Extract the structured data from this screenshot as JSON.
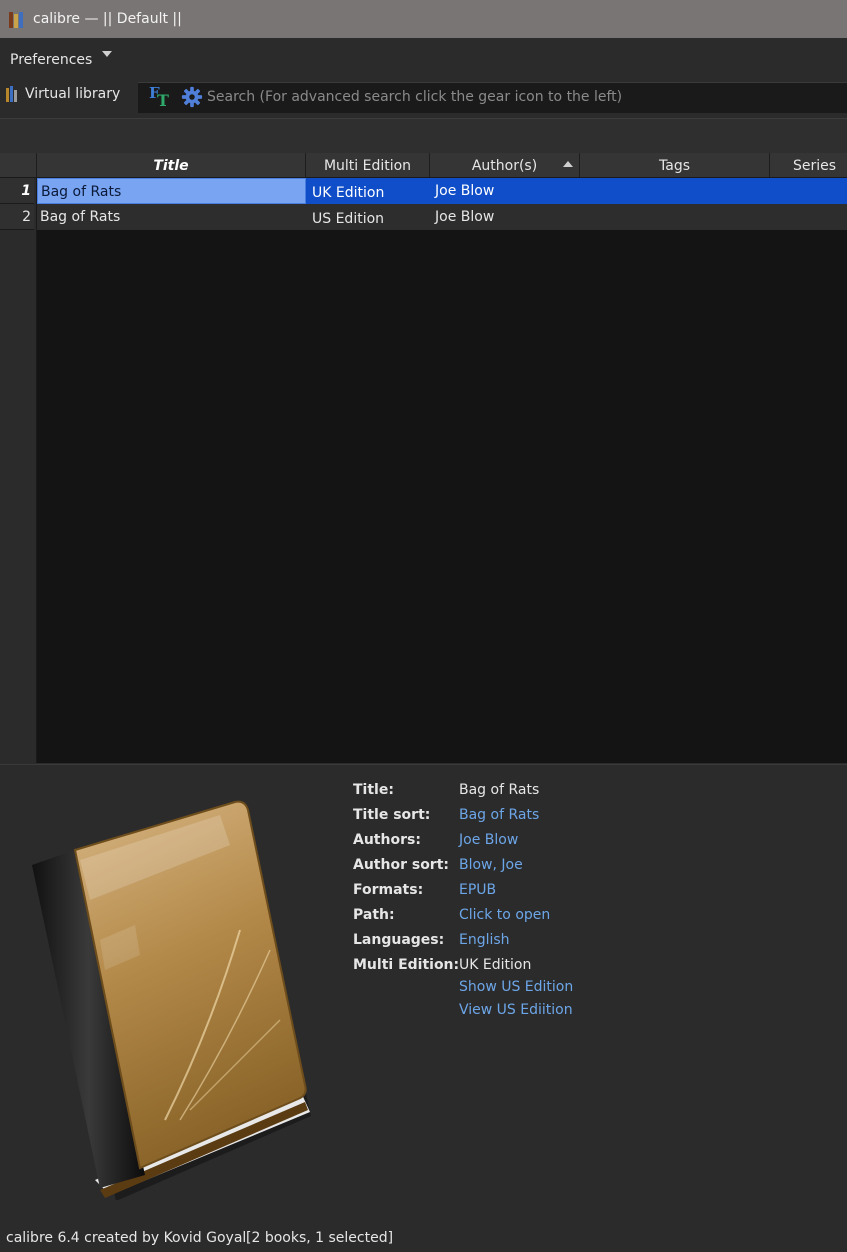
{
  "window": {
    "title": "calibre — || Default ||"
  },
  "menubar": {
    "preferences_label": "Preferences"
  },
  "search": {
    "virtual_library_label": "Virtual library",
    "placeholder": "Search (For advanced search click the gear icon to the left)",
    "value": ""
  },
  "table": {
    "columns": [
      {
        "label": "Title",
        "sorted": true
      },
      {
        "label": "Multi Edition"
      },
      {
        "label": "Author(s)",
        "sort_indicator": "ascending"
      },
      {
        "label": "Tags"
      },
      {
        "label": "Series"
      }
    ],
    "rows": [
      {
        "num": "1",
        "title": "Bag of Rats",
        "multi_edition": "UK Edition",
        "authors": "Joe Blow",
        "tags": "",
        "series": "",
        "selected": true
      },
      {
        "num": "2",
        "title": "Bag of Rats",
        "multi_edition": "US Edition",
        "authors": "Joe Blow",
        "tags": "",
        "series": "",
        "selected": false
      }
    ]
  },
  "details": {
    "fields": [
      {
        "label": "Title:",
        "value": "Bag of Rats",
        "link": false
      },
      {
        "label": "Title sort:",
        "value": "Bag of Rats",
        "link": true
      },
      {
        "label": "Authors:",
        "value": "Joe Blow",
        "link": true
      },
      {
        "label": "Author sort:",
        "value": "Blow, Joe",
        "link": true
      },
      {
        "label": "Formats:",
        "value": "EPUB",
        "link": true
      },
      {
        "label": "Path:",
        "value": "Click to open",
        "link": true
      },
      {
        "label": "Languages:",
        "value": "English",
        "link": true
      },
      {
        "label": "Multi Edition:",
        "value": "UK Edition",
        "link": false
      }
    ],
    "extra_links": [
      "Show US Edition",
      "View US Ediition"
    ]
  },
  "status": {
    "left": "calibre 6.4 created by Kovid Goyal",
    "right": "[2 books, 1 selected]"
  },
  "colors": {
    "selection": "#0f4ec8",
    "selected_title_cell": "#79a4f2",
    "link": "#6da6e8",
    "titlebar": "#7a7575"
  },
  "icons": {
    "app": "calibre-books-icon",
    "virtual_library": "books-icon",
    "full_text_search": "ft-icon",
    "advanced_search": "gear-icon",
    "cover": "book-cover-icon"
  }
}
